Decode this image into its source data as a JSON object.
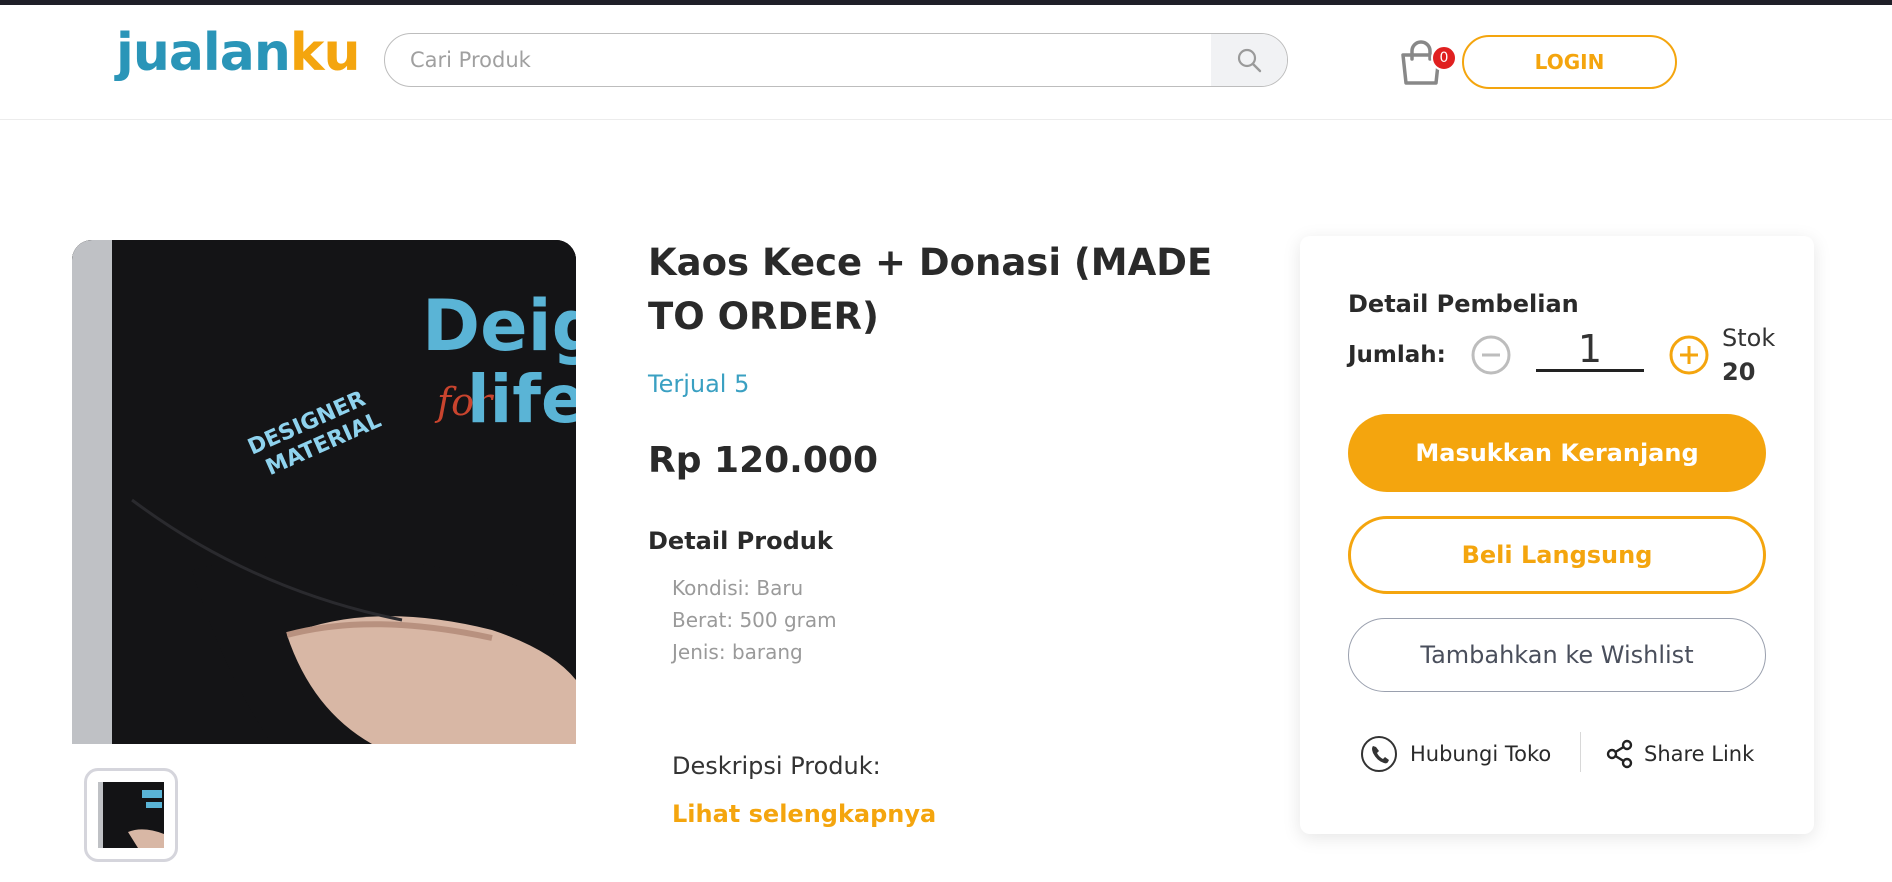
{
  "header": {
    "logo_part1": "jualan",
    "logo_part2": "ku",
    "search_placeholder": "Cari Produk",
    "search_icon": "search-icon",
    "cart_icon": "shopping-bag-icon",
    "cart_count": "0",
    "login_label": "LOGIN"
  },
  "product": {
    "title": "Kaos Kece + Donasi (MADE TO ORDER)",
    "sold": "Terjual 5",
    "price": "Rp 120.000",
    "detail_heading": "Detail Produk",
    "specs": [
      "Kondisi: Baru",
      "Berat: 500 gram",
      "Jenis: barang"
    ],
    "image_text_sleeve_1": "DESIGNER",
    "image_text_sleeve_2": "MATERIAL",
    "image_text_shirt_1": "Deign",
    "image_text_shirt_2": "life.",
    "image_text_shirt_script": "for",
    "description_heading": "Deskripsi Produk:",
    "see_more": "Lihat selengkapnya"
  },
  "purchase": {
    "heading": "Detail Pembelian",
    "quantity_label": "Jumlah:",
    "quantity": "1",
    "stock_label": "Stok",
    "stock_value": "20",
    "add_to_cart": "Masukkan Keranjang",
    "buy_now": "Beli Langsung",
    "wishlist": "Tambahkan ke Wishlist",
    "contact_store": "Hubungi Toko",
    "share_link": "Share Link"
  },
  "colors": {
    "brand_blue": "#2a95b8",
    "accent_orange": "#f4a50e",
    "badge_red": "#e02020"
  }
}
